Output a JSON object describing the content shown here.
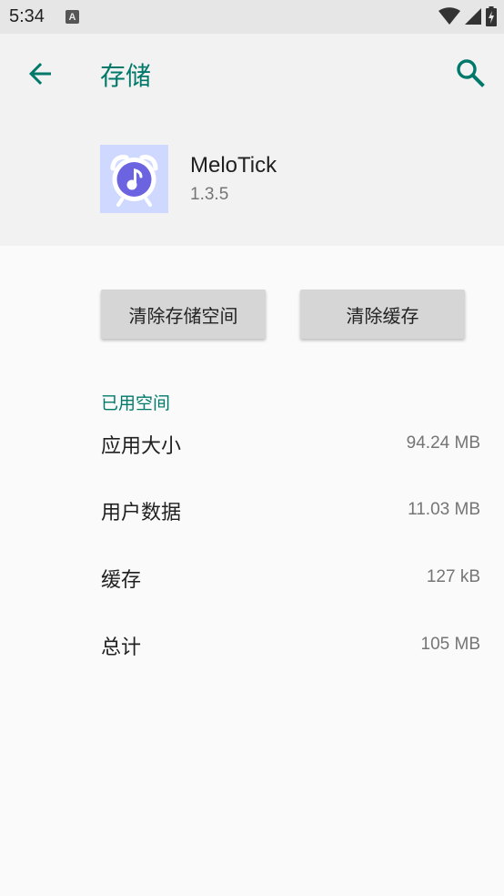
{
  "status_bar": {
    "time": "5:34",
    "notification_badge": "A"
  },
  "header": {
    "title": "存储"
  },
  "app": {
    "name": "MeloTick",
    "version": "1.3.5"
  },
  "buttons": {
    "clear_storage": "清除存储空间",
    "clear_cache": "清除缓存"
  },
  "storage": {
    "section_title": "已用空间",
    "rows": [
      {
        "label": "应用大小",
        "value": "94.24 MB"
      },
      {
        "label": "用户数据",
        "value": "11.03 MB"
      },
      {
        "label": "缓存",
        "value": "127 kB"
      },
      {
        "label": "总计",
        "value": "105 MB"
      }
    ]
  },
  "colors": {
    "accent": "#00796b",
    "status_bar_bg": "#e6e6e6",
    "header_bg": "#f2f2f2",
    "button_bg": "#d6d6d6",
    "app_icon_bg": "#cfd9ff"
  },
  "icons": {
    "back": "arrow-left-icon",
    "search": "search-icon",
    "wifi": "wifi-icon",
    "signal": "signal-icon",
    "battery": "battery-icon",
    "app": "alarm-clock-music-icon"
  }
}
